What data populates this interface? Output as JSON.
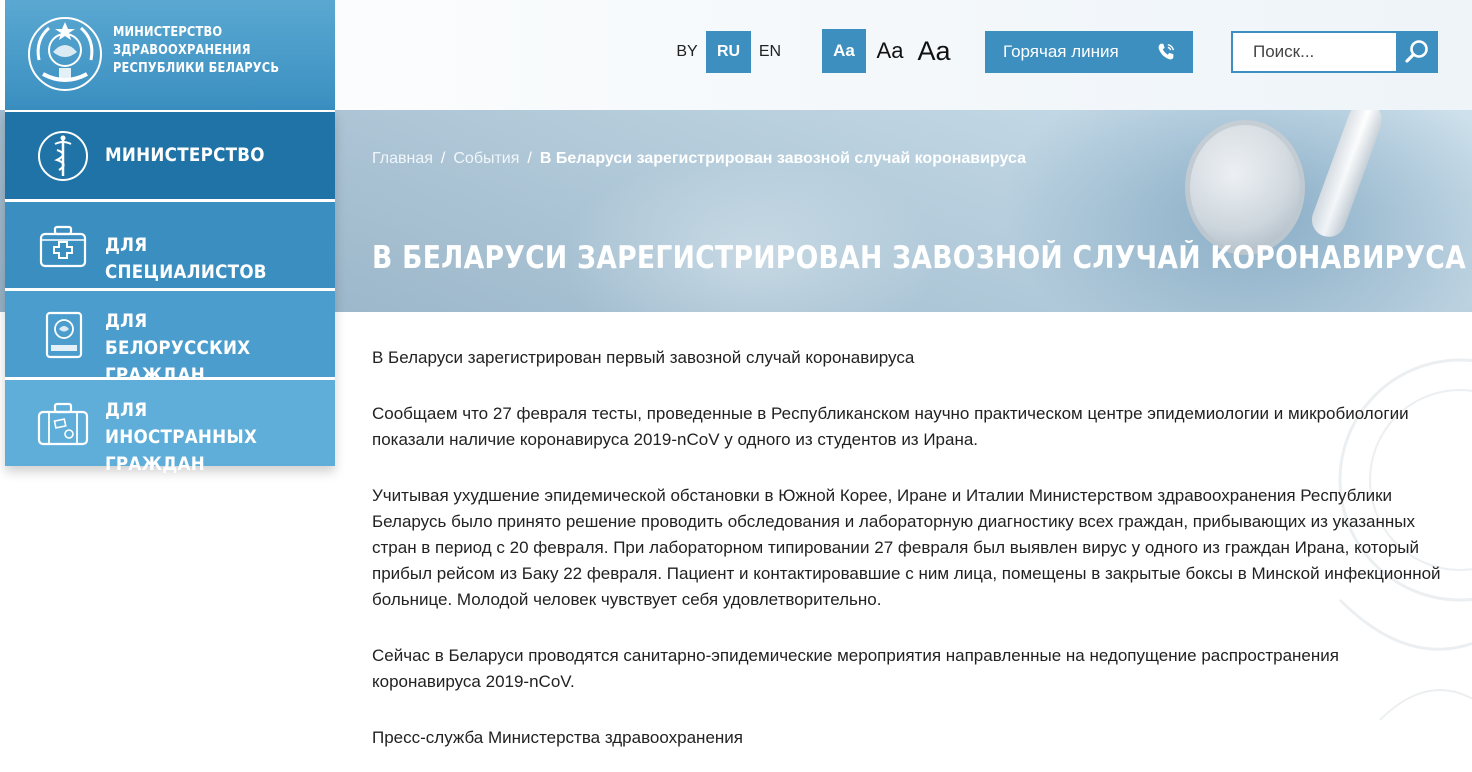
{
  "header": {
    "logo_lines": [
      "МИНИСТЕРСТВО",
      "ЗДРАВООХРАНЕНИЯ",
      "РЕСПУБЛИКИ БЕЛАРУСЬ"
    ],
    "languages": [
      {
        "code": "BY",
        "active": false
      },
      {
        "code": "RU",
        "active": true
      },
      {
        "code": "EN",
        "active": false
      }
    ],
    "font_sizes": [
      "Aa",
      "Aa",
      "Aa"
    ],
    "hotline_label": "Горячая линия",
    "search_placeholder": "Поиск..."
  },
  "sidebar": {
    "items": [
      {
        "lines": [
          "МИНИСТЕРСТВО"
        ],
        "icon": "caduceus-icon"
      },
      {
        "lines": [
          "ДЛЯ СПЕЦИАЛИСТОВ"
        ],
        "icon": "first-aid-kit-icon"
      },
      {
        "lines": [
          "ДЛЯ БЕЛОРУССКИХ",
          "ГРАЖДАН"
        ],
        "icon": "passport-icon"
      },
      {
        "lines": [
          "ДЛЯ ИНОСТРАННЫХ",
          "ГРАЖДАН"
        ],
        "icon": "suitcase-icon"
      }
    ]
  },
  "breadcrumb": {
    "home": "Главная",
    "section": "События",
    "separator": "/",
    "current": "В Беларуси зарегистрирован завозной случай коронавируса"
  },
  "page_title": "В БЕЛАРУСИ ЗАРЕГИСТРИРОВАН ЗАВОЗНОЙ СЛУЧАЙ КОРОНАВИРУСА",
  "article": {
    "paragraphs": [
      "В Беларуси зарегистрирован первый завозной случай коронавируса",
      "Сообщаем что 27 февраля тесты, проведенные в Республиканском научно практическом центре эпидемиологии и микробиологии показали наличие коронавируса 2019-nCoV у одного из студентов из Ирана.",
      "Учитывая ухудшение эпидемической обстановки в Южной Корее, Иране и Италии Министерством здравоохранения Республики Беларусь было принято решение проводить обследования и лабораторную диагностику всех граждан, прибывающих из указанных стран в период с 20 февраля. При лабораторном типировании 27 февраля был выявлен вирус у одного из граждан Ирана, который прибыл рейсом из Баку 22 февраля. Пациент и контактировавшие с ним лица, помещены в закрытые боксы в Минской инфекционной больнице. Молодой человек чувствует себя удовлетворительно.",
      "Сейчас в Беларуси проводятся санитарно-эпидемические мероприятия направленные на недопущение распространения коронавируса 2019-nCoV.",
      "Пресс-служба Министерства здравоохранения"
    ]
  },
  "colors": {
    "accent": "#3c8fbf",
    "nav_dark": "#1f73a6",
    "nav_light": "#5eaed9"
  }
}
